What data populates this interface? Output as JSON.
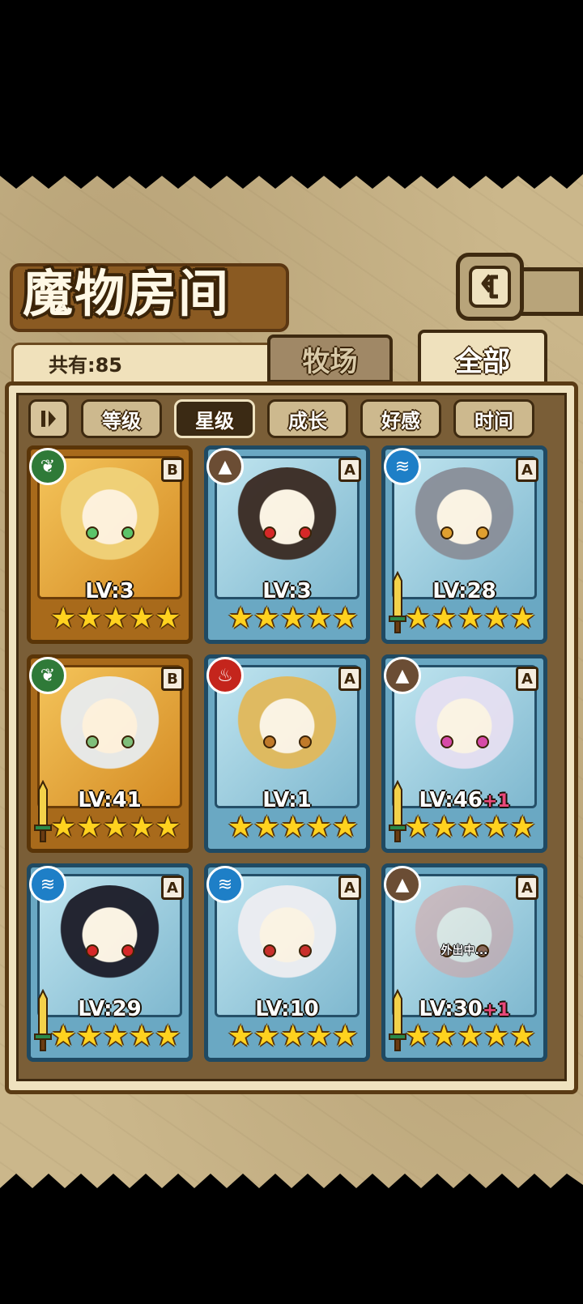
{
  "header": {
    "title": "魔物房间"
  },
  "summary": {
    "total_label": "共有:85"
  },
  "tabs": [
    {
      "label": "牧场",
      "active": false
    },
    {
      "label": "全部",
      "active": true
    }
  ],
  "sort": {
    "buttons": [
      {
        "label": "等级",
        "active": false
      },
      {
        "label": "星级",
        "active": true
      },
      {
        "label": "成长",
        "active": false
      },
      {
        "label": "好感",
        "active": false
      },
      {
        "label": "时间",
        "active": false
      }
    ]
  },
  "monsters": [
    {
      "level": "LV:3",
      "plus": "",
      "rank": "B",
      "element": "leaf-icon",
      "frame": "gold",
      "stars": 5,
      "weapon": false,
      "status": ""
    },
    {
      "level": "LV:3",
      "plus": "",
      "rank": "A",
      "element": "mountain-icon",
      "frame": "blue",
      "stars": 5,
      "weapon": false,
      "status": ""
    },
    {
      "level": "LV:28",
      "plus": "",
      "rank": "A",
      "element": "water-icon",
      "frame": "blue",
      "stars": 5,
      "weapon": true,
      "status": ""
    },
    {
      "level": "LV:41",
      "plus": "",
      "rank": "B",
      "element": "leaf-icon",
      "frame": "gold",
      "stars": 5,
      "weapon": true,
      "status": ""
    },
    {
      "level": "LV:1",
      "plus": "",
      "rank": "A",
      "element": "fire-icon",
      "frame": "blue",
      "stars": 5,
      "weapon": false,
      "status": ""
    },
    {
      "level": "LV:46",
      "plus": "+1",
      "rank": "A",
      "element": "mountain-icon",
      "frame": "blue",
      "stars": 5,
      "weapon": true,
      "status": ""
    },
    {
      "level": "LV:29",
      "plus": "",
      "rank": "A",
      "element": "water-icon",
      "frame": "blue",
      "stars": 5,
      "weapon": true,
      "status": ""
    },
    {
      "level": "LV:10",
      "plus": "",
      "rank": "A",
      "element": "water-icon",
      "frame": "blue",
      "stars": 5,
      "weapon": false,
      "status": ""
    },
    {
      "level": "LV:30",
      "plus": "+1",
      "rank": "A",
      "element": "mountain-icon",
      "frame": "blue",
      "stars": 5,
      "weapon": true,
      "status": "外出中..."
    }
  ],
  "colors": {
    "gold_frame": "#a86a1b",
    "blue_frame": "#6aa8c3",
    "star": "#ffd21f",
    "plus": "#e8487a"
  }
}
